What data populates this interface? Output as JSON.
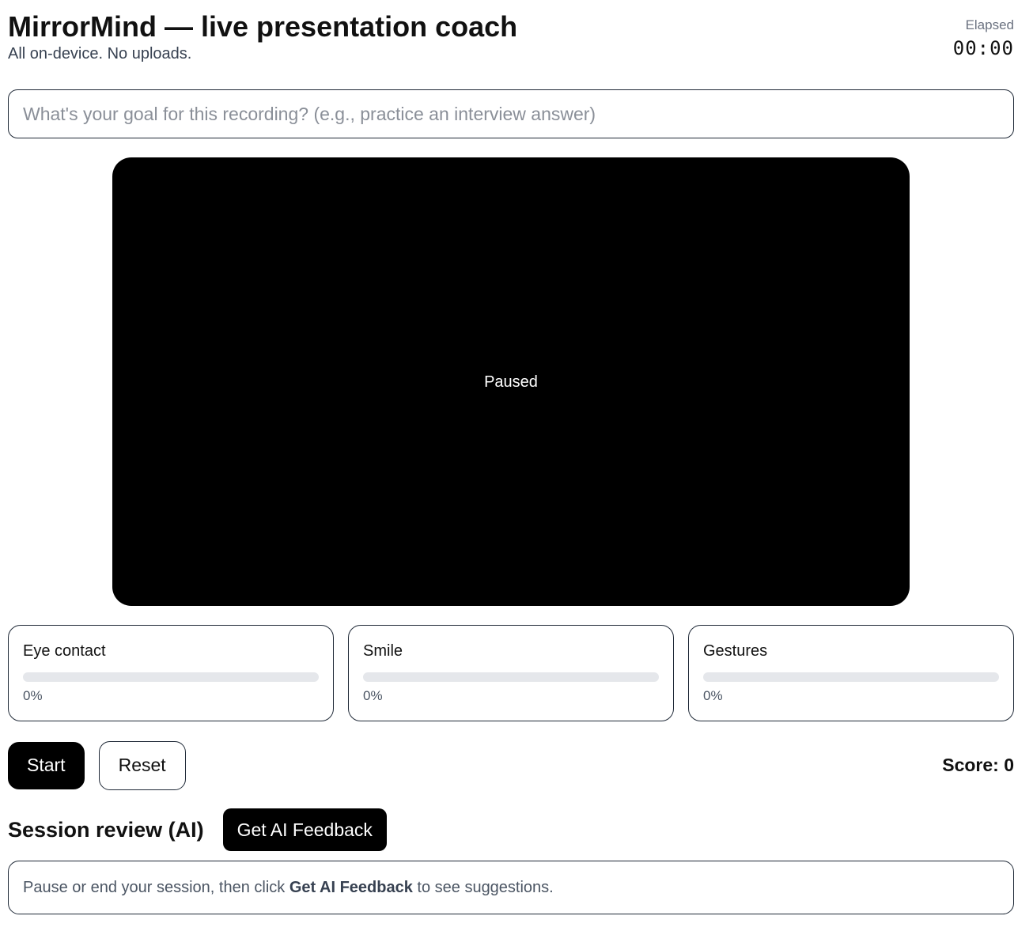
{
  "header": {
    "title": "MirrorMind — live presentation coach",
    "subtitle": "All on-device. No uploads.",
    "timer_label": "Elapsed",
    "timer_value": "00:00"
  },
  "goal": {
    "value": "",
    "placeholder": "What's your goal for this recording? (e.g., practice an interview answer)"
  },
  "video": {
    "status": "Paused"
  },
  "metrics": [
    {
      "label": "Eye contact",
      "value": "0%",
      "level": 0
    },
    {
      "label": "Smile",
      "value": "0%",
      "level": 0
    },
    {
      "label": "Gestures",
      "value": "0%",
      "level": 0
    }
  ],
  "controls": {
    "start_label": "Start",
    "reset_label": "Reset",
    "score_label": "Score: 0"
  },
  "review": {
    "title": "Session review (AI)",
    "feedback_button_label": "Get AI Feedback",
    "hint_before": "Pause or end your session, then click ",
    "hint_bold": "Get AI Feedback",
    "hint_after": " to see suggestions."
  },
  "colors": {
    "accent": "#000000",
    "border": "#1f2937",
    "track": "#e5e7eb",
    "muted_text": "#4b5563"
  }
}
